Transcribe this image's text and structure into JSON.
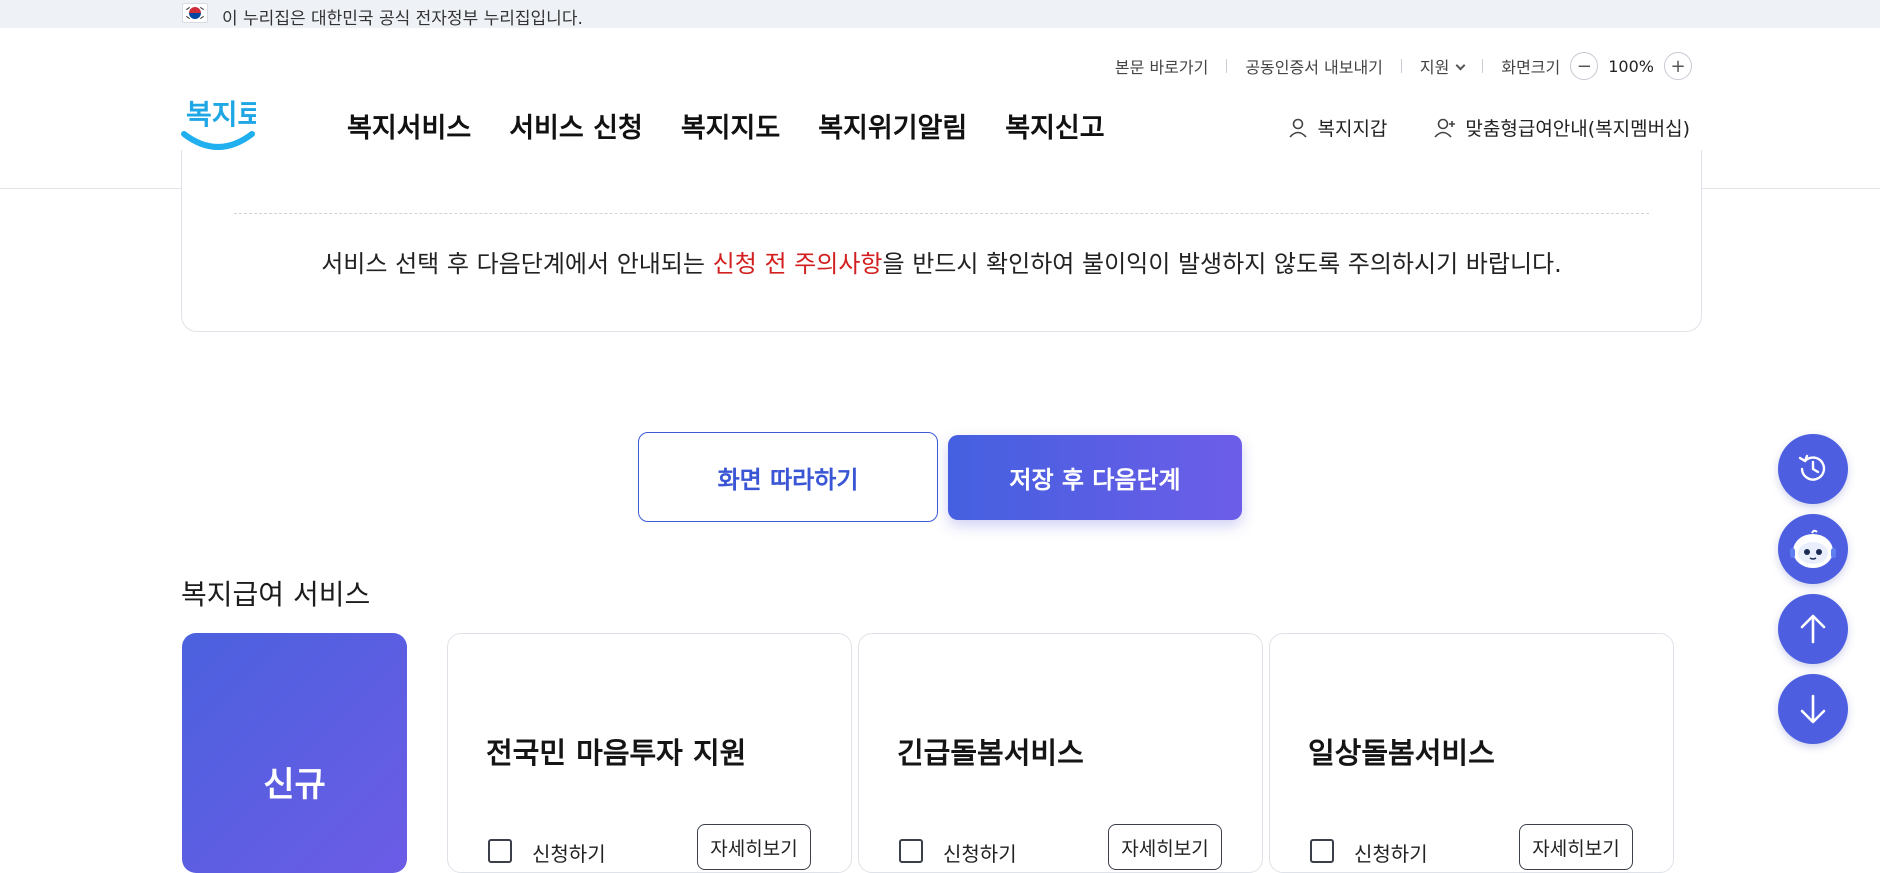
{
  "banner": {
    "text": "이 누리집은 대한민국 공식 전자정부 누리집입니다."
  },
  "util": {
    "skip": "본문 바로가기",
    "cert": "공동인증서 내보내기",
    "support": "지원",
    "zoom_label": "화면크기",
    "zoom_minus": "−",
    "zoom_value": "100%",
    "zoom_plus": "+"
  },
  "logo": {
    "text": "복지로"
  },
  "gnb": [
    {
      "label": "복지서비스"
    },
    {
      "label": "서비스 신청"
    },
    {
      "label": "복지지도"
    },
    {
      "label": "복지위기알림"
    },
    {
      "label": "복지신고"
    }
  ],
  "header_links": {
    "wallet": "복지지갑",
    "membership": "맞춤형급여안내(복지멤버십)"
  },
  "notice": {
    "msg_before": "서비스 선택 후 다음단계에서 안내되는 ",
    "msg_highlight": "신청 전 주의사항",
    "msg_after": "을 반드시 확인하여 불이익이 발생하지 않도록 주의하시기 바랍니다."
  },
  "actions": {
    "follow": "화면 따라하기",
    "save_next": "저장 후 다음단계"
  },
  "section": {
    "title": "복지급여 서비스",
    "new_label": "신규",
    "services": [
      {
        "name": "전국민 마음투자 지원",
        "apply": "신청하기",
        "detail": "자세히보기"
      },
      {
        "name": "긴급돌봄서비스",
        "apply": "신청하기",
        "detail": "자세히보기"
      },
      {
        "name": "일상돌봄서비스",
        "apply": "신청하기",
        "detail": "자세히보기"
      }
    ]
  },
  "fab_icons": [
    "history-icon",
    "chatbot-icon",
    "arrow-up-icon",
    "arrow-down-icon"
  ],
  "colors": {
    "primary": "#4d5fe0",
    "gradient_start": "#4460e0",
    "gradient_end": "#6d5de8",
    "highlight_red": "#d21f1f"
  }
}
